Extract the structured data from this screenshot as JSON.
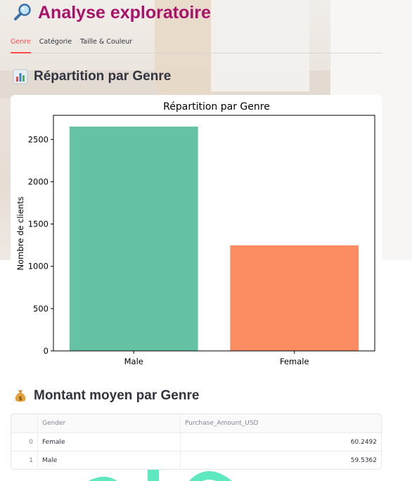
{
  "page": {
    "title": "Analyse exploratoire",
    "title_icon": "magnifier-icon",
    "accent_color": "#a8126a"
  },
  "tabs": [
    {
      "label": "Genre",
      "active": true
    },
    {
      "label": "Catégorie",
      "active": false
    },
    {
      "label": "Taille & Couleur",
      "active": false
    }
  ],
  "section1": {
    "title": "Répartition par Genre",
    "icon": "bar-chart-icon"
  },
  "chart_data": {
    "type": "bar",
    "title": "Répartition par Genre",
    "xlabel": "",
    "ylabel": "Nombre de clients",
    "categories": [
      "Male",
      "Female"
    ],
    "values": [
      2652,
      1248
    ],
    "colors": [
      "#66c2a5",
      "#fc8d62"
    ],
    "ylim": [
      0,
      2785
    ],
    "yticks": [
      0,
      500,
      1000,
      1500,
      2000,
      2500
    ],
    "grid": false
  },
  "section2": {
    "title": "Montant moyen par Genre",
    "icon": "money-bag-icon"
  },
  "table": {
    "columns": [
      "",
      "Gender",
      "Purchase_Amount_USD"
    ],
    "rows": [
      {
        "index": "0",
        "gender": "Female",
        "amount": "60.2492"
      },
      {
        "index": "1",
        "gender": "Male",
        "amount": "59.5362"
      }
    ]
  }
}
